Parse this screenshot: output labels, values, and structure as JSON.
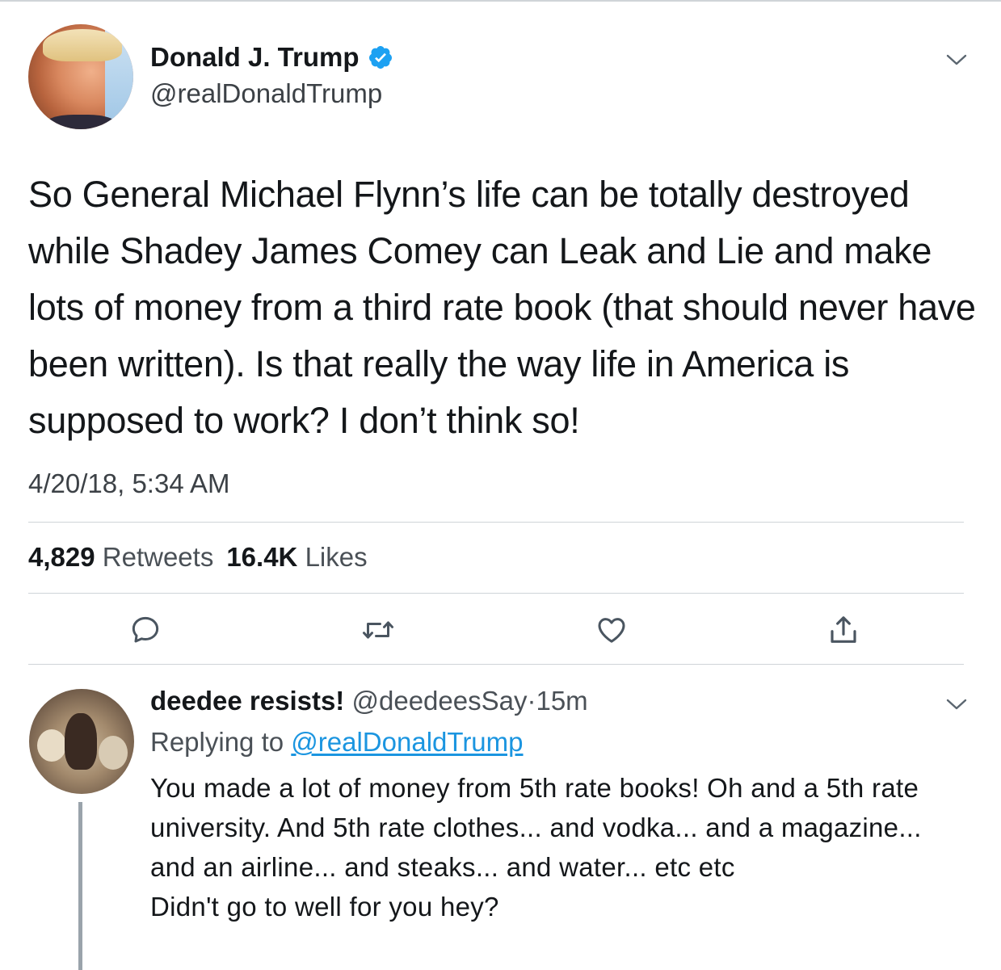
{
  "tweet": {
    "author_name": "Donald J. Trump",
    "author_handle": "@realDonaldTrump",
    "verified": true,
    "text": "So General Michael Flynn’s life can be totally destroyed while Shadey James Comey can Leak and Lie and make lots of money from a third rate book (that should never have been written). Is that really the way life in America is supposed to work? I don’t think so!",
    "timestamp": "4/20/18, 5:34 AM",
    "retweet_count": "4,829",
    "retweet_label": "Retweets",
    "like_count": "16.4K",
    "like_label": "Likes"
  },
  "actions": {
    "icons": [
      "reply-icon",
      "retweet-icon",
      "like-icon",
      "share-icon"
    ]
  },
  "reply": {
    "author_name": "deedee resists!",
    "author_handle": "@deedeesSay",
    "separator": "·",
    "age": "15m",
    "replying_prefix": "Replying to",
    "replying_to": "@realDonaldTrump",
    "text": "You made a lot of money from 5th rate books! Oh and a 5th rate university. And 5th rate clothes... and vodka... and a magazine... and an airline... and steaks... and water... etc etc\nDidn't go to well for you hey?"
  },
  "colors": {
    "verified_blue": "#1da1f2",
    "link_blue": "#1b95e0",
    "text_primary": "#14171a",
    "text_secondary": "#4a5056",
    "icon_gray": "#4a5560",
    "rule_gray": "#cfd4d8"
  }
}
